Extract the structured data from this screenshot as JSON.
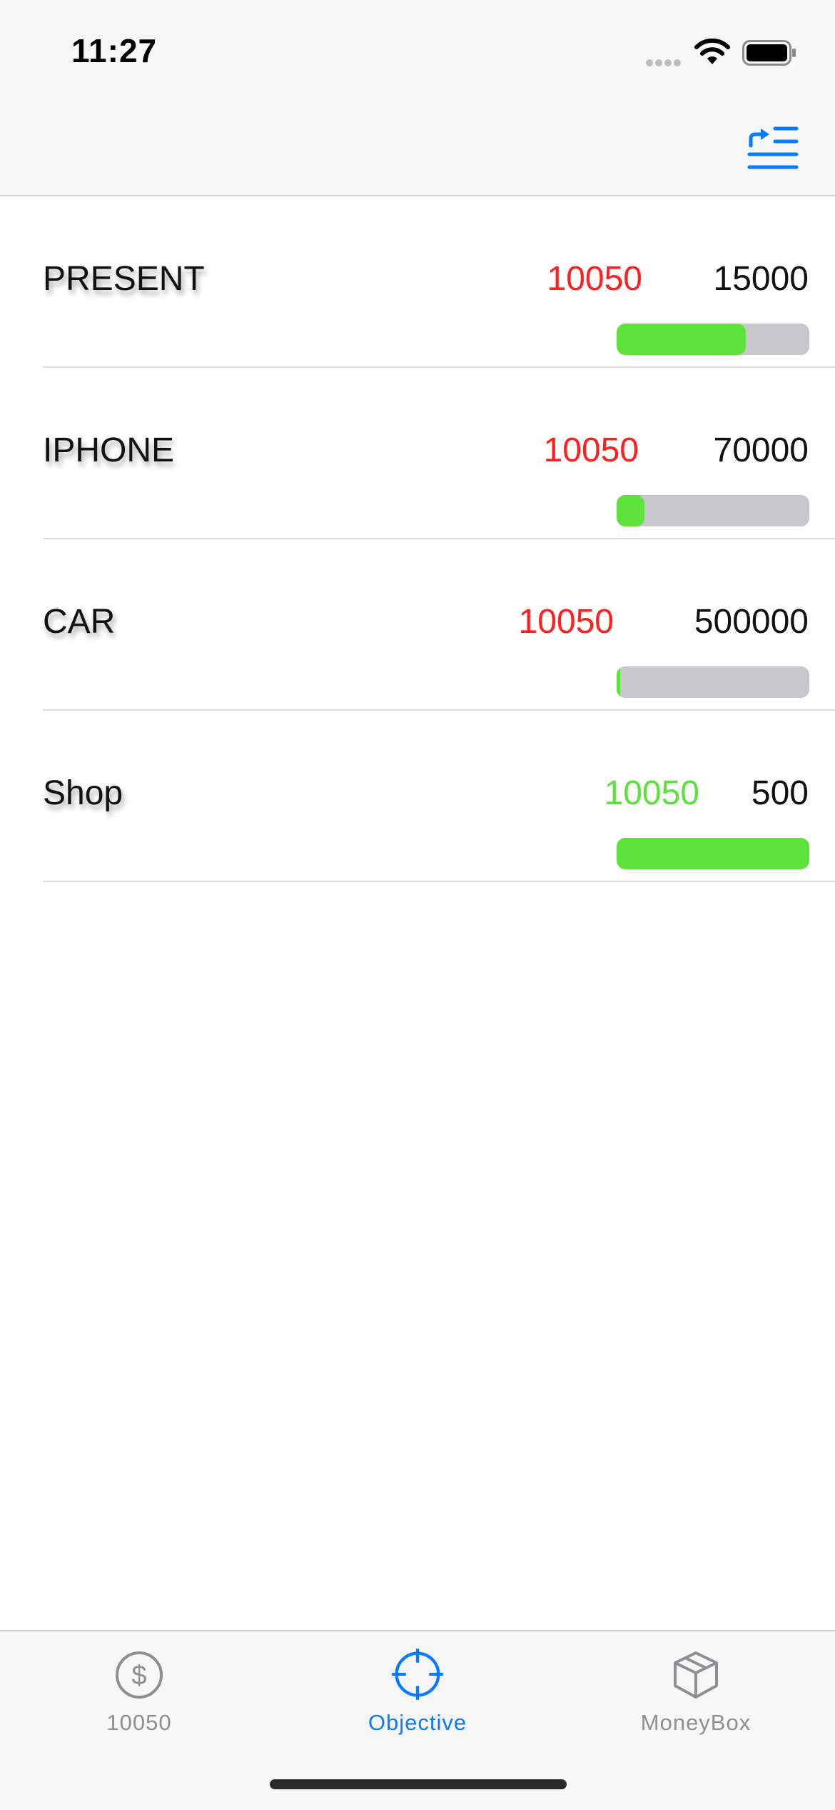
{
  "status_bar": {
    "time": "11:27"
  },
  "colors": {
    "accent": "#0a7aff",
    "over_budget": "#ff1f1f",
    "reached": "#5ce23a",
    "track": "#c8c8cc",
    "inactive_tab": "#8e8e93"
  },
  "nav_bar": {
    "action_icon": "list-indent-icon"
  },
  "goals": [
    {
      "name": "PRESENT",
      "current": "10050",
      "target": "15000",
      "current_color": "#ff1f1f",
      "progress": 0.67
    },
    {
      "name": "IPHONE",
      "current": "10050",
      "target": "70000",
      "current_color": "#ff1f1f",
      "progress": 0.144
    },
    {
      "name": "CAR",
      "current": "10050",
      "target": "500000",
      "current_color": "#ff1f1f",
      "progress": 0.02
    },
    {
      "name": "Shop",
      "current": "10050",
      "target": "500",
      "current_color": "#5ce23a",
      "progress": 1.0
    }
  ],
  "tab_bar": {
    "tabs": [
      {
        "label": "10050",
        "icon": "dollar-circle-icon",
        "active": false
      },
      {
        "label": "Objective",
        "icon": "crosshair-icon",
        "active": true
      },
      {
        "label": "MoneyBox",
        "icon": "box-icon",
        "active": false
      }
    ]
  }
}
